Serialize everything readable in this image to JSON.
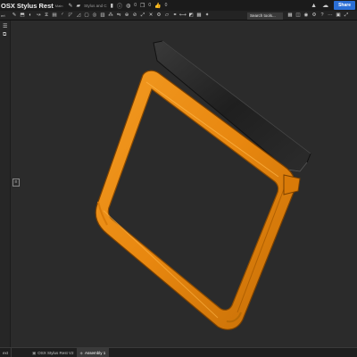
{
  "document": {
    "title": "OSX Stylus Rest",
    "subtitle": "Main"
  },
  "header": {
    "folder_label": "Stylus and C",
    "count_1": "0",
    "count_2": "0",
    "count_3": "0",
    "share_label": "Share",
    "search_placeholder": "Search tools..."
  },
  "left_toolbar_label": "ert",
  "tabs": [
    {
      "label": "ext",
      "active": false
    },
    {
      "label": "OSX Stylus Rest V2",
      "active": false
    },
    {
      "label": "Assembly 1",
      "active": true
    }
  ],
  "colors": {
    "accent": "#2b6fd6",
    "frame_orange": "#e8870f",
    "stylus_dark": "#1f1f1f",
    "viewport_bg": "#2b2b2b"
  },
  "icons": {
    "toolbar": [
      "sketch-icon",
      "extrude-icon",
      "revolve-icon",
      "sweep-icon",
      "loft-icon",
      "thicken-icon",
      "fillet-icon",
      "chamfer-icon",
      "draft-icon",
      "shell-icon",
      "hole-icon",
      "rib-icon",
      "pattern-icon",
      "mirror-icon",
      "boolean-icon",
      "split-icon",
      "transform-icon",
      "delete-icon",
      "modify-icon",
      "plane-icon",
      "mate-icon",
      "measure-icon",
      "section-icon",
      "view-icon",
      "render-icon"
    ],
    "toolbar_right": [
      "grid-icon",
      "display-icon",
      "camera-icon",
      "settings-icon",
      "help-icon",
      "more-icon",
      "cube-icon",
      "expand-icon"
    ]
  }
}
